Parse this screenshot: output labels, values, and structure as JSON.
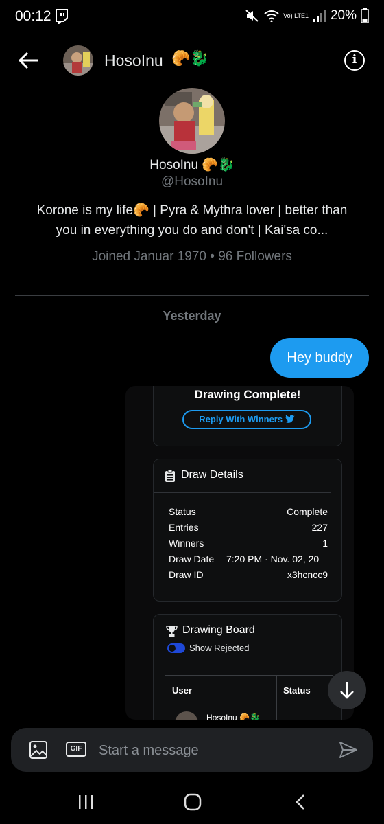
{
  "status_bar": {
    "time": "00:12",
    "battery": "20%",
    "network": "Vo) LTE1"
  },
  "header": {
    "name": "HosoInu",
    "emoji": "🥐🐉"
  },
  "profile": {
    "name": "HosoInu",
    "emoji": "🥐🐉",
    "handle": "@HosoInu",
    "bio": "Korone is my life🥐 | Pyra & Mythra lover | better than you in everything you do and don't | Kai'sa co...",
    "meta": "Joined Januar 1970 • 96 Followers"
  },
  "conversation": {
    "day_label": "Yesterday",
    "messages": [
      {
        "text": "Hey buddy"
      }
    ]
  },
  "card": {
    "complete_title": "Drawing Complete!",
    "reply_button": "Reply With Winners",
    "details_title": "Draw Details",
    "details": [
      {
        "label": "Status",
        "value": "Complete"
      },
      {
        "label": "Entries",
        "value": "227"
      },
      {
        "label": "Winners",
        "value": "1"
      },
      {
        "label": "Draw Date",
        "value": "7:20 PM · Nov. 02, 20"
      },
      {
        "label": "Draw ID",
        "value": "x3hcncc9"
      }
    ],
    "board_title": "Drawing Board",
    "show_rejected_label": "Show Rejected",
    "table_headers": {
      "user": "User",
      "status": "Status"
    },
    "first_row_user": "HosoInu 🥐🐉"
  },
  "composer": {
    "placeholder": "Start a message",
    "gif_label": "GIF"
  },
  "icons": {
    "back": "arrow-left-icon",
    "info": "info-icon",
    "image": "image-icon",
    "gif": "gif-icon",
    "send": "send-icon",
    "scroll": "arrow-down-icon"
  },
  "colors": {
    "accent": "#1d9bf0",
    "background": "#000000",
    "muted": "#71767b",
    "toggle": "#1e48d8"
  }
}
